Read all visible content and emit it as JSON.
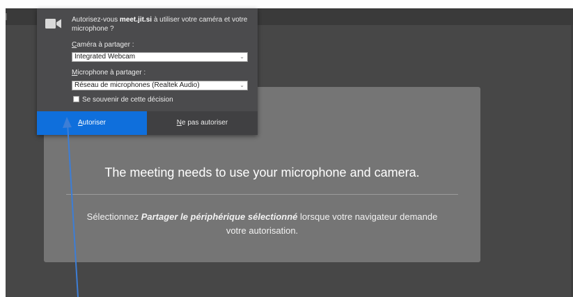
{
  "popup": {
    "prompt_prefix": "Autorisez-vous ",
    "site": "meet.jit.si",
    "prompt_suffix": " à utiliser votre caméra et votre microphone ?",
    "camera_label_key": "C",
    "camera_label_rest": "améra à partager :",
    "camera_value": "Integrated Webcam",
    "mic_label_key": "M",
    "mic_label_rest": "icrophone à partager :",
    "mic_value": "Réseau de microphones (Realtek Audio)",
    "remember_label": "Se souvenir de cette décision",
    "allow_key": "A",
    "allow_rest": "utoriser",
    "deny_key": "N",
    "deny_rest": "e pas autoriser"
  },
  "card": {
    "title": "The meeting needs to use your microphone and camera.",
    "desc_prefix": "Sélectionnez ",
    "desc_emphasis": "Partager le périphérique sélectionné",
    "desc_suffix_line1": " lorsque votre navigateur demande",
    "desc_line2": "votre autorisation."
  },
  "colors": {
    "accent": "#0f6fdc",
    "annotation_arrow": "#3d7ed6"
  }
}
